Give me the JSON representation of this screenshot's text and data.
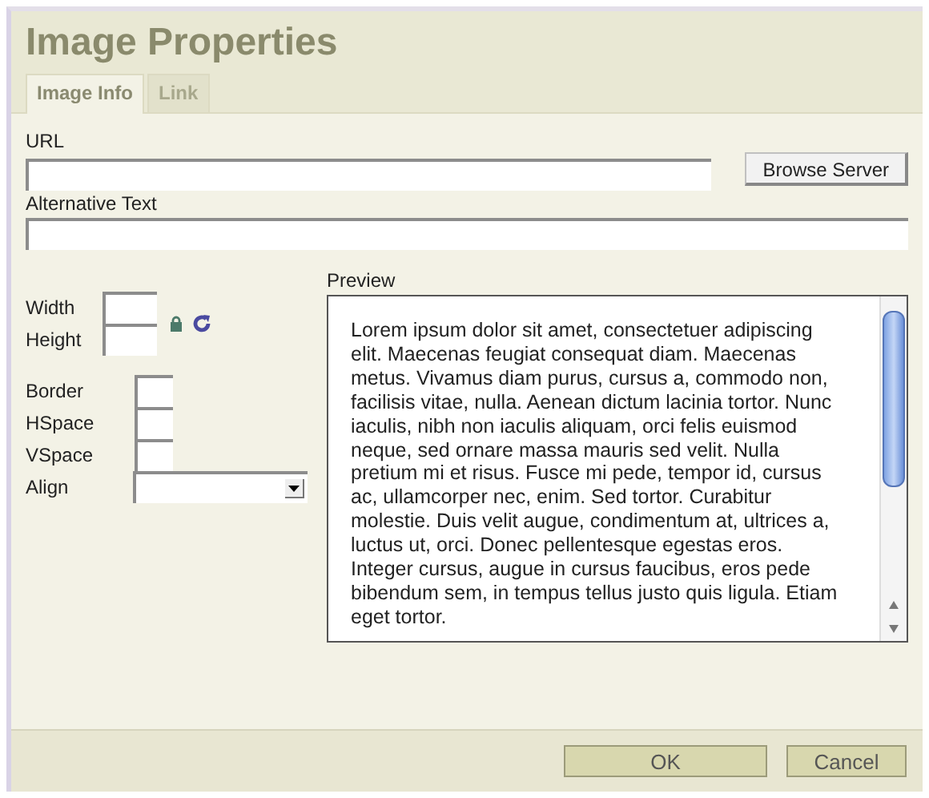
{
  "window": {
    "title": "Image Properties"
  },
  "tabs": [
    {
      "label": "Image Info",
      "selected": true
    },
    {
      "label": "Link",
      "selected": false
    }
  ],
  "url": {
    "label": "URL"
  },
  "browse_button": "Browse Server",
  "alt_text": {
    "label": "Alternative Text"
  },
  "size_fields": [
    {
      "label": "Width"
    },
    {
      "label": "Height"
    }
  ],
  "spacing_fields": [
    {
      "label": "Border"
    },
    {
      "label": "HSpace"
    },
    {
      "label": "VSpace"
    }
  ],
  "align": {
    "label": "Align"
  },
  "preview": {
    "label": "Preview",
    "text": "Lorem ipsum dolor sit amet, consectetuer adipiscing elit. Maecenas feugiat consequat diam. Maecenas metus. Vivamus diam purus, cursus a, commodo non, facilisis vitae, nulla. Aenean dictum lacinia tortor. Nunc iaculis, nibh non iaculis aliquam, orci felis euismod neque, sed ornare massa mauris sed velit. Nulla pretium mi et risus. Fusce mi pede, tempor id, cursus ac, ullamcorper nec, enim. Sed tortor. Curabitur molestie. Duis velit augue, condimentum at, ultrices a, luctus ut, orci. Donec pellentesque egestas eros. Integer cursus, augue in cursus faucibus, eros pede bibendum sem, in tempus tellus justo quis ligula. Etiam eget tortor."
  },
  "buttons": [
    {
      "label": "OK"
    },
    {
      "label": "Cancel"
    }
  ]
}
